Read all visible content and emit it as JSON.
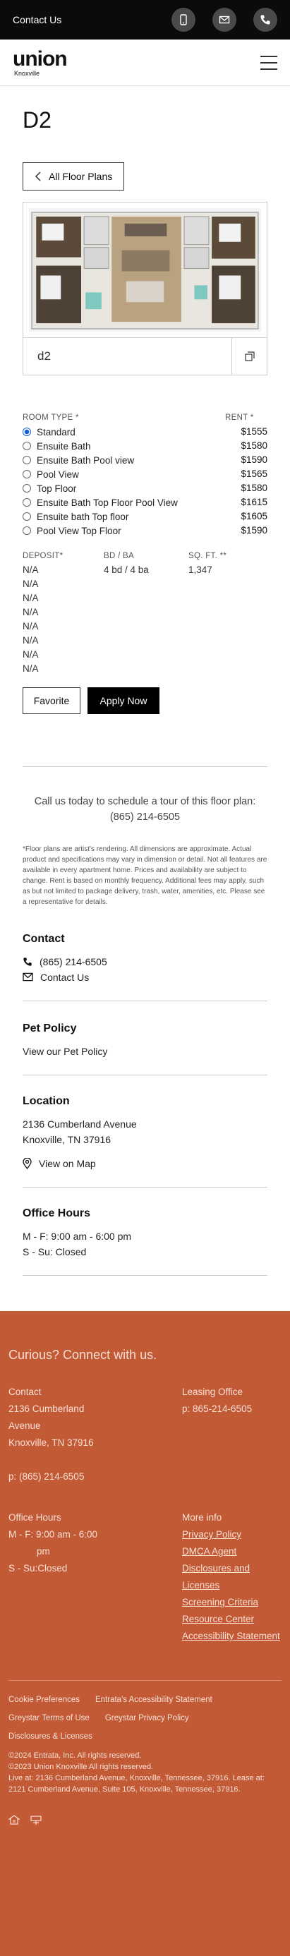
{
  "topbar": {
    "contact_label": "Contact Us"
  },
  "header": {
    "logo_word": "union",
    "logo_city": "Knoxville"
  },
  "page": {
    "title": "D2",
    "back_label": "All Floor Plans",
    "plan_name": "d2"
  },
  "table": {
    "room_type_header": "ROOM TYPE *",
    "rent_header": "RENT *",
    "rooms": [
      {
        "label": "Standard",
        "rent": "$1555",
        "selected": true
      },
      {
        "label": "Ensuite Bath",
        "rent": "$1580"
      },
      {
        "label": "Ensuite Bath Pool view",
        "rent": "$1590"
      },
      {
        "label": "Pool View",
        "rent": "$1565"
      },
      {
        "label": "Top Floor",
        "rent": "$1580"
      },
      {
        "label": "Ensuite Bath Top Floor Pool View",
        "rent": "$1615"
      },
      {
        "label": "Ensuite bath Top floor",
        "rent": "$1605"
      },
      {
        "label": "Pool View Top Floor",
        "rent": "$1590"
      }
    ],
    "deposit_header": "DEPOSIT*",
    "bdba_header": "BD / BA",
    "sqft_header": "SQ. FT. **",
    "deposits": [
      "N/A",
      "N/A",
      "N/A",
      "N/A",
      "N/A",
      "N/A",
      "N/A",
      "N/A"
    ],
    "bdba": "4 bd / 4 ba",
    "sqft": "1,347"
  },
  "actions": {
    "favorite": "Favorite",
    "apply": "Apply Now"
  },
  "cta": {
    "line1": "Call us today to schedule a tour of this floor plan:",
    "phone": "(865) 214-6505"
  },
  "fineprint": "*Floor plans are artist's rendering. All dimensions are approximate. Actual product and specifications may vary in dimension or detail. Not all features are available in every apartment home. Prices and availability are subject to change. Rent is based on monthly frequency. Additional fees may apply, such as but not limited to package delivery, trash, water, amenities, etc. Please see a representative for details.",
  "contact": {
    "heading": "Contact",
    "phone": "(865) 214-6505",
    "email_label": "Contact Us"
  },
  "pet": {
    "heading": "Pet Policy",
    "link": "View our Pet Policy"
  },
  "location": {
    "heading": "Location",
    "street": "2136 Cumberland Avenue",
    "city": "Knoxville, TN 37916",
    "map_label": "View on Map"
  },
  "office": {
    "heading": "Office Hours",
    "weekday": "M - F:  9:00 am - 6:00 pm",
    "weekend": "S - Su:  Closed"
  },
  "footer": {
    "curious": "Curious? Connect with us.",
    "contact_head": "Contact",
    "street1": "2136 Cumberland",
    "street2": "Avenue",
    "city": "Knoxville, TN 37916",
    "phone": "p: (865) 214-6505",
    "leasing_head": "Leasing Office",
    "leasing_phone": "p: 865-214-6505",
    "hours_head": "Office Hours",
    "hours_weekday": "M - F: 9:00 am - 6:00",
    "hours_pm": "pm",
    "hours_weekend": "S - Su:Closed",
    "more_head": "More info",
    "more_links": [
      "Privacy Policy",
      "DMCA Agent",
      "Disclosures and Licenses",
      "Screening Criteria",
      "Resource Center",
      "Accessibility Statement"
    ],
    "bottom_links": [
      "Cookie Preferences",
      "Entrata's Accessibility Statement",
      "Greystar Terms of Use",
      "Greystar Privacy Policy",
      "Disclosures & Licenses"
    ],
    "copy1": "©2024 Entrata, Inc. All rights reserved.",
    "copy2": "©2023 Union Knoxville All rights reserved.",
    "copy3": "Live at: 2136 Cumberland Avenue, Knoxville, Tennessee, 37916. Lease at: 2121 Cumberland Avenue, Suite 105, Knoxville, Tennessee, 37916."
  }
}
